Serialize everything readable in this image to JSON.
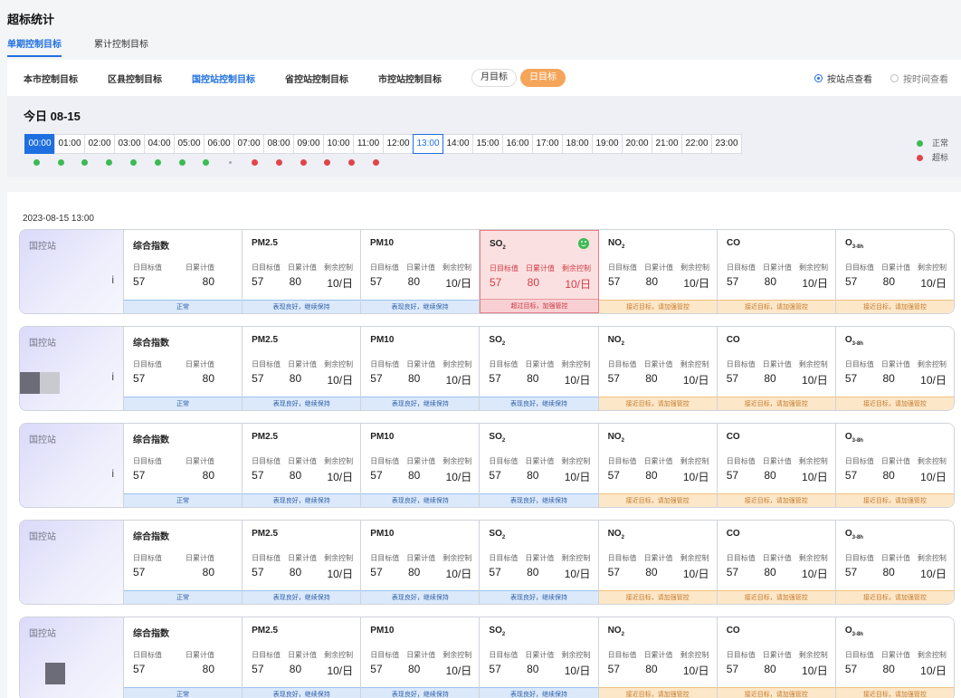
{
  "title": "超标统计",
  "top_tabs": [
    {
      "label": "单期控制目标",
      "active": true
    },
    {
      "label": "累计控制目标",
      "active": false
    }
  ],
  "filter_tabs": [
    {
      "label": "本市控制目标",
      "active": false
    },
    {
      "label": "区县控制目标",
      "active": false
    },
    {
      "label": "国控站控制目标",
      "active": true
    },
    {
      "label": "省控站控制目标",
      "active": false
    },
    {
      "label": "市控站控制目标",
      "active": false
    }
  ],
  "period_toggle": [
    {
      "label": "月目标",
      "active": false
    },
    {
      "label": "日目标",
      "active": true
    }
  ],
  "view_modes": [
    {
      "label": "按站点查看",
      "checked": true
    },
    {
      "label": "按时间查看",
      "checked": false
    }
  ],
  "today_label": "今日 08-15",
  "hours": [
    "00:00",
    "01:00",
    "02:00",
    "03:00",
    "04:00",
    "05:00",
    "06:00",
    "07:00",
    "08:00",
    "09:00",
    "10:00",
    "11:00",
    "12:00",
    "13:00",
    "14:00",
    "15:00",
    "16:00",
    "17:00",
    "18:00",
    "19:00",
    "20:00",
    "21:00",
    "22:00",
    "23:00"
  ],
  "selected_hour_index": 0,
  "current_hour_index": 13,
  "hour_status": [
    "green",
    "green",
    "green",
    "green",
    "green",
    "green",
    "green",
    "green",
    "grey",
    "red",
    "red",
    "red",
    "red",
    "red",
    "red"
  ],
  "legend": {
    "normal": "正常",
    "exceed": "超标"
  },
  "colors": {
    "accent": "#1f6fe0",
    "normal": "#3cba54",
    "exceed": "#e0454b",
    "warn": "#f5a55a"
  },
  "list_time": "2023-08-15 13:00",
  "metric_labels": {
    "target": "日目标值",
    "cumulative": "日累计值",
    "remaining": "剩余控制"
  },
  "rows": [
    {
      "station": "国控站",
      "mark": "i",
      "cells": [
        {
          "title": "综合指数",
          "target": "57",
          "cumulative": "80",
          "status": "正常",
          "level": "ok"
        },
        {
          "title": "PM2.5",
          "target": "57",
          "cumulative": "80",
          "remaining": "10/日",
          "status": "表现良好，继续保持",
          "level": "ok"
        },
        {
          "title": "PM10",
          "target": "57",
          "cumulative": "80",
          "remaining": "10/日",
          "status": "表现良好，继续保持",
          "level": "ok"
        },
        {
          "title": "SO",
          "sub": "2",
          "target": "57",
          "cumulative": "80",
          "remaining": "10/日",
          "status": "超过目标，加强管控",
          "level": "bad",
          "icon": "smile-face-icon"
        },
        {
          "title": "NO",
          "sub": "2",
          "target": "57",
          "cumulative": "80",
          "remaining": "10/日",
          "status": "接近目标，请加强管控",
          "level": "warn"
        },
        {
          "title": "CO",
          "target": "57",
          "cumulative": "80",
          "remaining": "10/日",
          "status": "接近目标，请加强管控",
          "level": "warn"
        },
        {
          "title": "O",
          "sub": "3-8h",
          "target": "57",
          "cumulative": "80",
          "remaining": "10/日",
          "status": "接近目标，请加强管控",
          "level": "warn"
        }
      ]
    },
    {
      "station": "国控站",
      "mark": "i",
      "cells": [
        {
          "title": "综合指数",
          "target": "57",
          "cumulative": "80",
          "status": "正常",
          "level": "ok"
        },
        {
          "title": "PM2.5",
          "target": "57",
          "cumulative": "80",
          "remaining": "10/日",
          "status": "表现良好，继续保持",
          "level": "ok"
        },
        {
          "title": "PM10",
          "target": "57",
          "cumulative": "80",
          "remaining": "10/日",
          "status": "表现良好，继续保持",
          "level": "ok"
        },
        {
          "title": "SO",
          "sub": "2",
          "target": "57",
          "cumulative": "80",
          "remaining": "10/日",
          "status": "表现良好，继续保持",
          "level": "ok"
        },
        {
          "title": "NO",
          "sub": "2",
          "target": "57",
          "cumulative": "80",
          "remaining": "10/日",
          "status": "接近目标，请加强管控",
          "level": "warn"
        },
        {
          "title": "CO",
          "target": "57",
          "cumulative": "80",
          "remaining": "10/日",
          "status": "接近目标，请加强管控",
          "level": "warn"
        },
        {
          "title": "O",
          "sub": "3-8h",
          "target": "57",
          "cumulative": "80",
          "remaining": "10/日",
          "status": "接近目标，请加强管控",
          "level": "warn"
        }
      ]
    },
    {
      "station": "国控站",
      "mark": "i",
      "cells": [
        {
          "title": "综合指数",
          "target": "57",
          "cumulative": "80",
          "status": "正常",
          "level": "ok"
        },
        {
          "title": "PM2.5",
          "target": "57",
          "cumulative": "80",
          "remaining": "10/日",
          "status": "表现良好，继续保持",
          "level": "ok"
        },
        {
          "title": "PM10",
          "target": "57",
          "cumulative": "80",
          "remaining": "10/日",
          "status": "表现良好，继续保持",
          "level": "ok"
        },
        {
          "title": "SO",
          "sub": "2",
          "target": "57",
          "cumulative": "80",
          "remaining": "10/日",
          "status": "表现良好，继续保持",
          "level": "ok"
        },
        {
          "title": "NO",
          "sub": "2",
          "target": "57",
          "cumulative": "80",
          "remaining": "10/日",
          "status": "接近目标，请加强管控",
          "level": "warn"
        },
        {
          "title": "CO",
          "target": "57",
          "cumulative": "80",
          "remaining": "10/日",
          "status": "接近目标，请加强管控",
          "level": "warn"
        },
        {
          "title": "O",
          "sub": "3-8h",
          "target": "57",
          "cumulative": "80",
          "remaining": "10/日",
          "status": "接近目标，请加强管控",
          "level": "warn"
        }
      ]
    },
    {
      "station": "国控站",
      "mark": "",
      "cells": [
        {
          "title": "综合指数",
          "target": "57",
          "cumulative": "80",
          "status": "正常",
          "level": "ok"
        },
        {
          "title": "PM2.5",
          "target": "57",
          "cumulative": "80",
          "remaining": "10/日",
          "status": "表现良好，继续保持",
          "level": "ok"
        },
        {
          "title": "PM10",
          "target": "57",
          "cumulative": "80",
          "remaining": "10/日",
          "status": "表现良好，继续保持",
          "level": "ok"
        },
        {
          "title": "SO",
          "sub": "2",
          "target": "57",
          "cumulative": "80",
          "remaining": "10/日",
          "status": "表现良好，继续保持",
          "level": "ok"
        },
        {
          "title": "NO",
          "sub": "2",
          "target": "57",
          "cumulative": "80",
          "remaining": "10/日",
          "status": "接近目标，请加强管控",
          "level": "warn"
        },
        {
          "title": "CO",
          "target": "57",
          "cumulative": "80",
          "remaining": "10/日",
          "status": "接近目标，请加强管控",
          "level": "warn"
        },
        {
          "title": "O",
          "sub": "3-8h",
          "target": "57",
          "cumulative": "80",
          "remaining": "10/日",
          "status": "接近目标，请加强管控",
          "level": "warn"
        }
      ]
    },
    {
      "station": "国控站",
      "mark": "",
      "cells": [
        {
          "title": "综合指数",
          "target": "57",
          "cumulative": "80",
          "status": "正常",
          "level": "ok"
        },
        {
          "title": "PM2.5",
          "target": "57",
          "cumulative": "80",
          "remaining": "10/日",
          "status": "表现良好，继续保持",
          "level": "ok"
        },
        {
          "title": "PM10",
          "target": "57",
          "cumulative": "80",
          "remaining": "10/日",
          "status": "表现良好，继续保持",
          "level": "ok"
        },
        {
          "title": "SO",
          "sub": "2",
          "target": "57",
          "cumulative": "80",
          "remaining": "10/日",
          "status": "表现良好，继续保持",
          "level": "ok"
        },
        {
          "title": "NO",
          "sub": "2",
          "target": "57",
          "cumulative": "80",
          "remaining": "10/日",
          "status": "接近目标，请加强管控",
          "level": "warn"
        },
        {
          "title": "CO",
          "target": "57",
          "cumulative": "80",
          "remaining": "10/日",
          "status": "接近目标，请加强管控",
          "level": "warn"
        },
        {
          "title": "O",
          "sub": "3-8h",
          "target": "57",
          "cumulative": "80",
          "remaining": "10/日",
          "status": "接近目标，请加强管控",
          "level": "warn"
        }
      ]
    }
  ]
}
